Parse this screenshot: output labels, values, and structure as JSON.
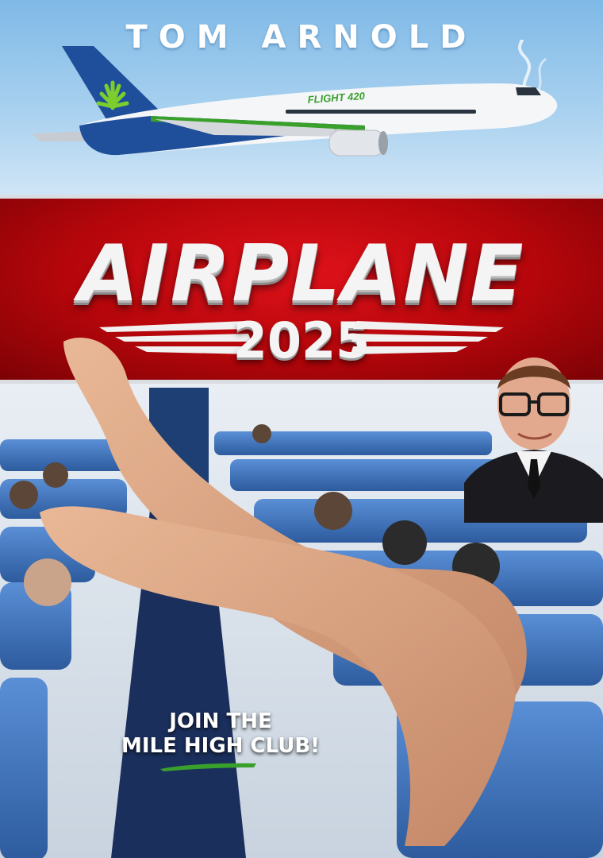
{
  "actor": {
    "name": "TOM ARNOLD"
  },
  "plane": {
    "livery": "FLIGHT 420"
  },
  "title": {
    "main": "AIRPLANE",
    "year": "2025"
  },
  "tagline": {
    "line1": "JOIN THE",
    "line2": "MILE HIGH CLUB!"
  },
  "colors": {
    "sky": "#a7d0ef",
    "title_band": "#c4080e",
    "title_text": "#f4f4f4",
    "seat_blue": "#3d6fb8",
    "accent_green": "#3aa02c",
    "plane_tail": "#1f4f9a"
  },
  "icons": {
    "tail_logo": "cannabis-leaf-icon",
    "underline": "green-brush-stroke"
  }
}
